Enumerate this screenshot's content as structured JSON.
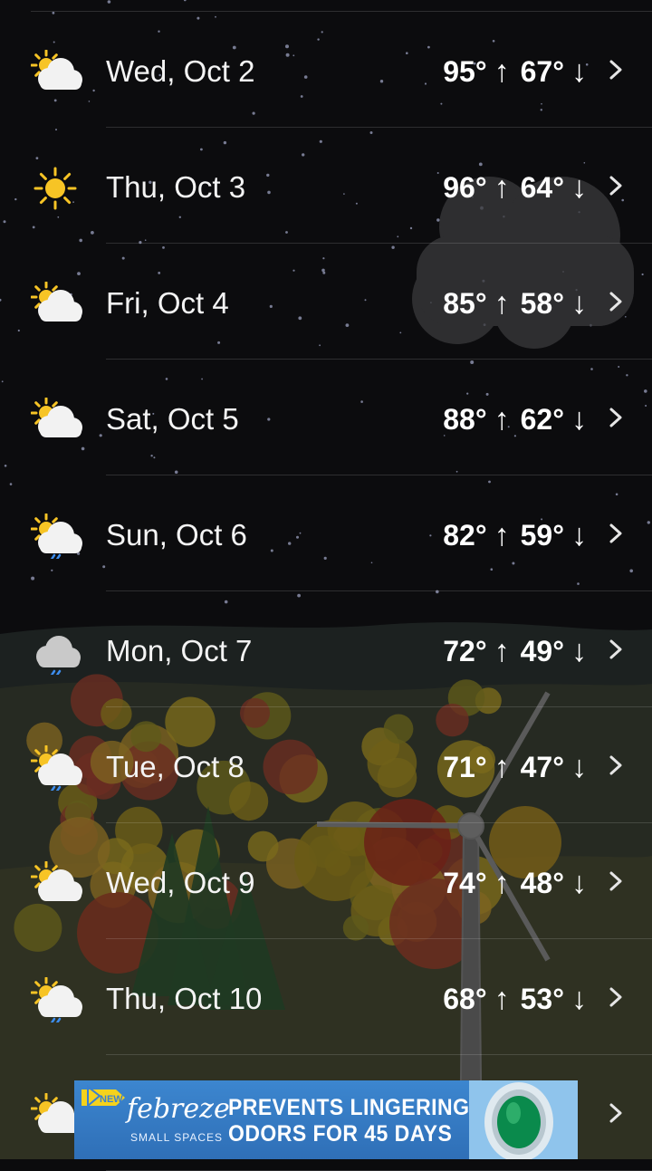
{
  "forecast": [
    {
      "date": "Wed, Oct 2",
      "high": "95°",
      "low": "67°",
      "icon": "partly-sunny-icon"
    },
    {
      "date": "Thu, Oct 3",
      "high": "96°",
      "low": "64°",
      "icon": "sun-icon"
    },
    {
      "date": "Fri, Oct 4",
      "high": "85°",
      "low": "58°",
      "icon": "partly-sunny-icon"
    },
    {
      "date": "Sat, Oct 5",
      "high": "88°",
      "low": "62°",
      "icon": "partly-sunny-icon"
    },
    {
      "date": "Sun, Oct 6",
      "high": "82°",
      "low": "59°",
      "icon": "partly-sunny-rain-icon"
    },
    {
      "date": "Mon, Oct 7",
      "high": "72°",
      "low": "49°",
      "icon": "cloud-rain-icon"
    },
    {
      "date": "Tue, Oct 8",
      "high": "71°",
      "low": "47°",
      "icon": "partly-sunny-rain-icon"
    },
    {
      "date": "Wed, Oct 9",
      "high": "74°",
      "low": "48°",
      "icon": "partly-sunny-icon"
    },
    {
      "date": "Thu, Oct 10",
      "high": "68°",
      "low": "53°",
      "icon": "partly-sunny-rain-icon"
    },
    {
      "date": "",
      "high": "",
      "low": "",
      "icon": "partly-sunny-icon"
    }
  ],
  "arrows": {
    "up": "↑",
    "down": "↓"
  },
  "ad": {
    "badge": "NEW",
    "brand": "febreze",
    "brand_sub": "SMALL SPACES",
    "line1": "PREVENTS LINGERING",
    "line2": "ODORS FOR 45 DAYS"
  },
  "colors": {
    "sun": "#f7c425",
    "cloud": "#f2f2f2",
    "rain": "#3d8ef0",
    "ad_blue": "#3479c4"
  }
}
